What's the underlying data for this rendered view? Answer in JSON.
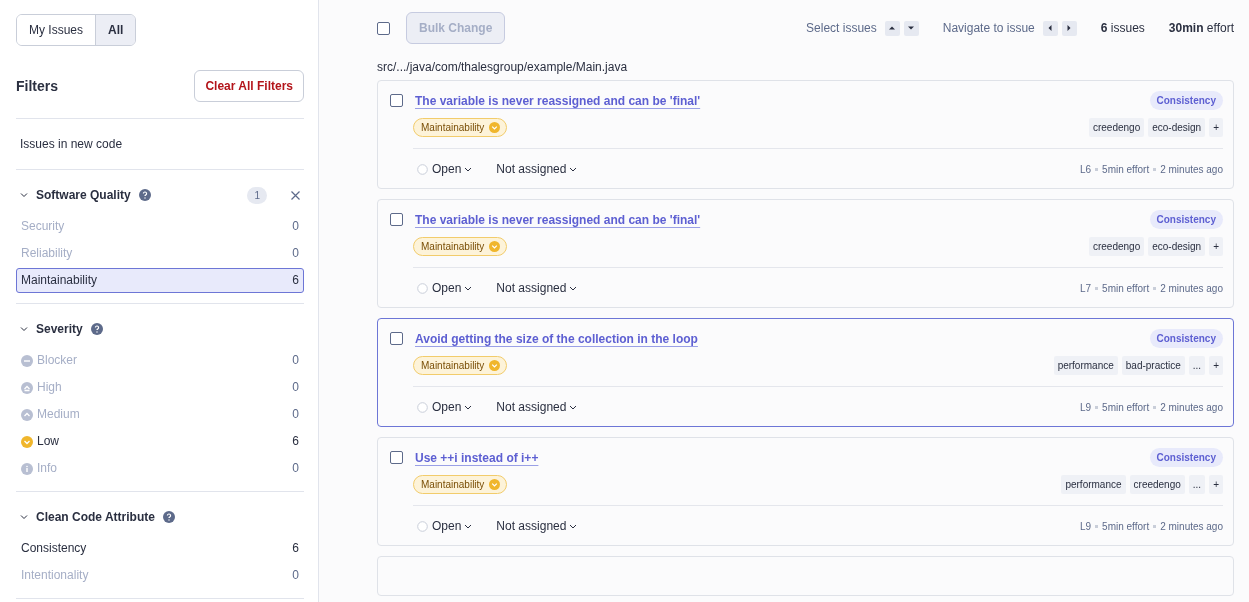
{
  "scope_toggle": [
    {
      "label": "My Issues",
      "selected": false
    },
    {
      "label": "All",
      "selected": true
    }
  ],
  "filters": {
    "title": "Filters",
    "clear_button": "Clear All Filters",
    "new_code": "Issues in new code",
    "sections": [
      {
        "title": "Software Quality",
        "expanded": true,
        "count_badge": "1",
        "items": [
          {
            "label": "Security",
            "count": "0",
            "disabled": true,
            "selected": false
          },
          {
            "label": "Reliability",
            "count": "0",
            "disabled": true,
            "selected": false
          },
          {
            "label": "Maintainability",
            "count": "6",
            "disabled": false,
            "selected": true
          }
        ]
      },
      {
        "title": "Severity",
        "expanded": true,
        "items": [
          {
            "label": "Blocker",
            "count": "0",
            "disabled": true,
            "selected": false,
            "kind": "blocker"
          },
          {
            "label": "High",
            "count": "0",
            "disabled": true,
            "selected": false,
            "kind": "high"
          },
          {
            "label": "Medium",
            "count": "0",
            "disabled": true,
            "selected": false,
            "kind": "medium"
          },
          {
            "label": "Low",
            "count": "6",
            "disabled": false,
            "selected": false,
            "kind": "low"
          },
          {
            "label": "Info",
            "count": "0",
            "disabled": true,
            "selected": false,
            "kind": "info"
          }
        ]
      },
      {
        "title": "Clean Code Attribute",
        "expanded": true,
        "items": [
          {
            "label": "Consistency",
            "count": "6",
            "disabled": false,
            "selected": false
          },
          {
            "label": "Intentionality",
            "count": "0",
            "disabled": true,
            "selected": false
          }
        ]
      }
    ]
  },
  "toolbar": {
    "select_all": {
      "checked": false
    },
    "bulk_change": {
      "label": "Bulk Change",
      "disabled": true
    },
    "select_issues": "Select issues",
    "navigate": "Navigate to issue",
    "issue_count": "6",
    "issue_count_label": "issues",
    "effort": "30min",
    "effort_label": "effort"
  },
  "file_path": "src/.../java/com/thalesgroup/example/Main.java",
  "issues": [
    {
      "title": "The variable is never reassigned and can be 'final'",
      "checked": false,
      "selected": false,
      "attribute": "Consistency",
      "quality": "Maintainability",
      "tags": [
        "creedengo",
        "eco-design"
      ],
      "status": "Open",
      "assignee": "Not assigned",
      "line": "L6",
      "effort": "5min effort",
      "age": "2 minutes ago"
    },
    {
      "title": "The variable is never reassigned and can be 'final'",
      "checked": false,
      "selected": false,
      "attribute": "Consistency",
      "quality": "Maintainability",
      "tags": [
        "creedengo",
        "eco-design"
      ],
      "status": "Open",
      "assignee": "Not assigned",
      "line": "L7",
      "effort": "5min effort",
      "age": "2 minutes ago"
    },
    {
      "title": "Avoid getting the size of the collection in the loop",
      "checked": false,
      "selected": true,
      "attribute": "Consistency",
      "quality": "Maintainability",
      "tags": [
        "performance",
        "bad-practice"
      ],
      "more_tags": "...",
      "status": "Open",
      "assignee": "Not assigned",
      "line": "L9",
      "effort": "5min effort",
      "age": "2 minutes ago"
    },
    {
      "title": "Use ++i instead of i++",
      "checked": false,
      "selected": false,
      "attribute": "Consistency",
      "quality": "Maintainability",
      "tags": [
        "performance",
        "creedengo"
      ],
      "more_tags": "...",
      "status": "Open",
      "assignee": "Not assigned",
      "line": "L9",
      "effort": "5min effort",
      "age": "2 minutes ago"
    }
  ],
  "add_tag_symbol": "+"
}
